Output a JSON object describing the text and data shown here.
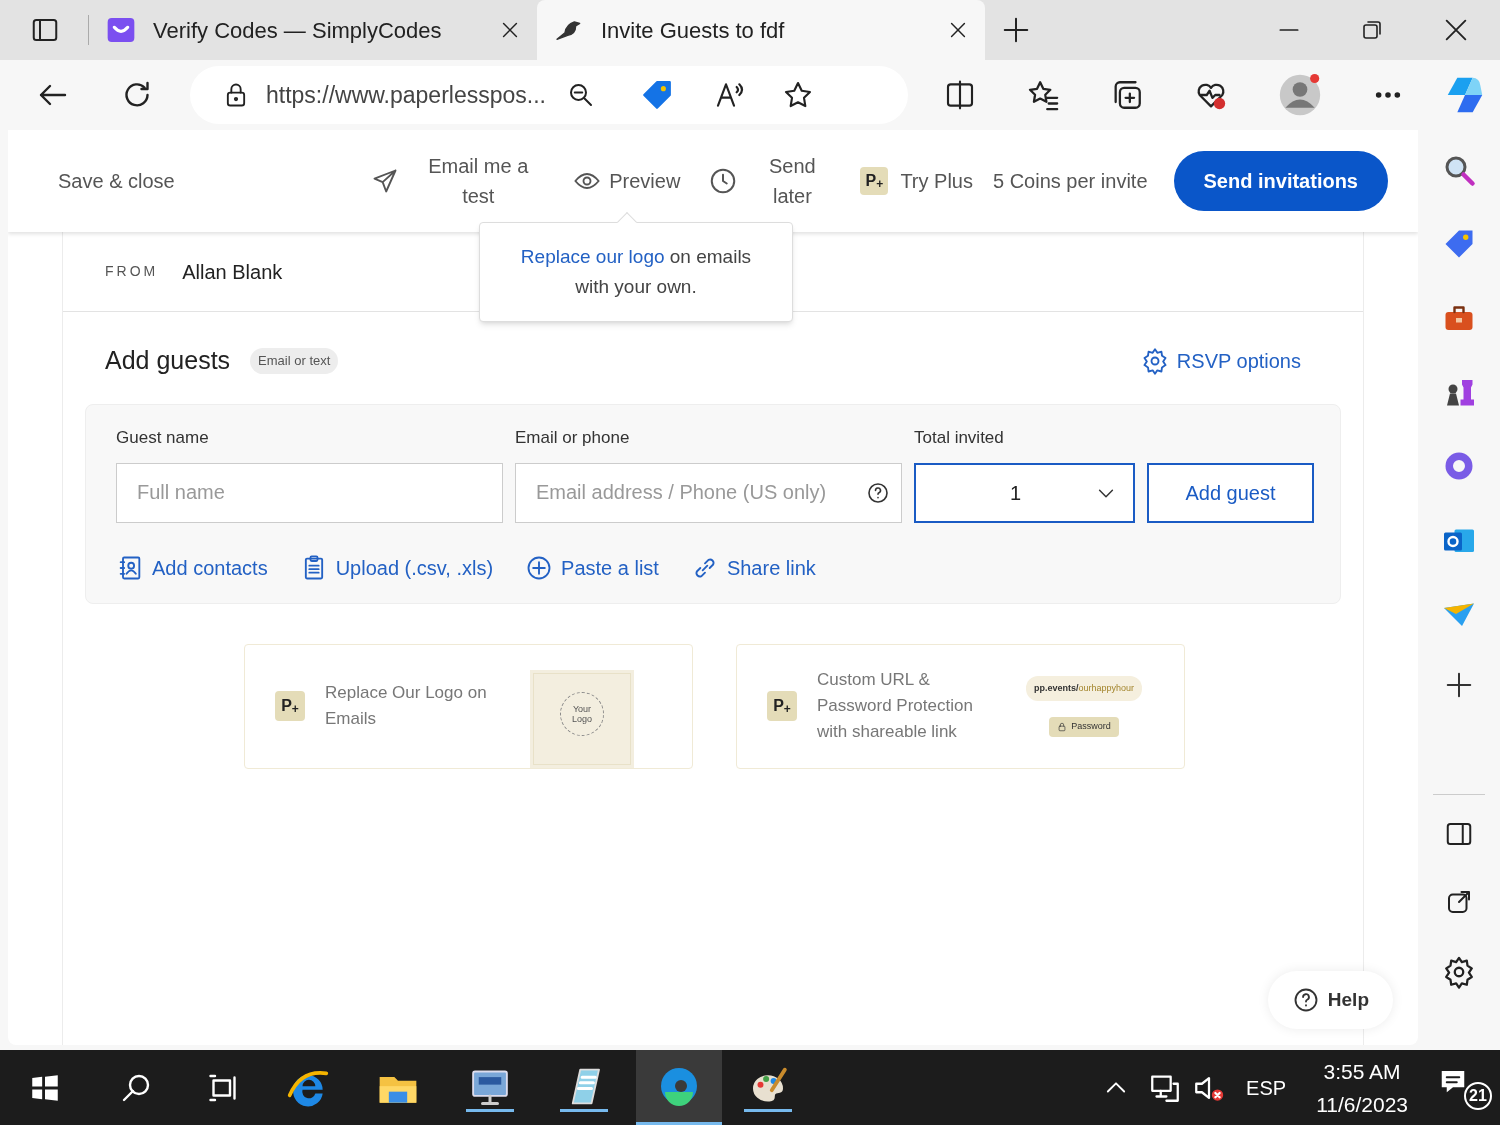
{
  "browser": {
    "tabs": [
      {
        "title": "Verify Codes — SimplyCodes",
        "selected": false
      },
      {
        "title": "Invite Guests to fdf",
        "selected": true
      }
    ],
    "url": "https://www.paperlesspos..."
  },
  "toolbar": {
    "save_close": "Save & close",
    "email_test": "Email me a test",
    "preview": "Preview",
    "send_later": "Send later",
    "plus_badge": "P$_{+}$",
    "try_plus": "Try Plus",
    "coins": "5 Coins per invite",
    "send_button": "Send invitations"
  },
  "tooltip": {
    "link": "Replace our logo",
    "text": " on emails with your own."
  },
  "from": {
    "label": "FROM",
    "name": "Allan Blank"
  },
  "add_guests": {
    "title": "Add guests",
    "badge": "Email or text",
    "rsvp": "RSVP options",
    "guest_name": {
      "label": "Guest name",
      "placeholder": "Full name"
    },
    "email": {
      "label": "Email or phone",
      "placeholder": "Email address / Phone (US only)"
    },
    "total": {
      "label": "Total invited",
      "value": "1"
    },
    "add_button": "Add guest",
    "actions": [
      {
        "kind": "contacts",
        "label": "Add contacts"
      },
      {
        "kind": "upload",
        "label": "Upload (.csv, .xls)"
      },
      {
        "kind": "paste",
        "label": "Paste a list"
      },
      {
        "kind": "link",
        "label": "Share link"
      }
    ]
  },
  "promos": [
    {
      "kind": "logo",
      "badge": "P$_{+}$",
      "text": "Replace Our Logo on Emails",
      "art_text": [
        "Your Logo"
      ]
    },
    {
      "kind": "url",
      "badge": "P$_{+}$",
      "text": "Custom URL & Password Protection with shareable link",
      "art_text": [
        "pp.events/",
        "ourhappyhour",
        "Password"
      ]
    }
  ],
  "help": "Help",
  "taskbar": {
    "language": "ESP",
    "time": "3:55 AM",
    "date": "11/6/2023",
    "notifications": "21"
  }
}
